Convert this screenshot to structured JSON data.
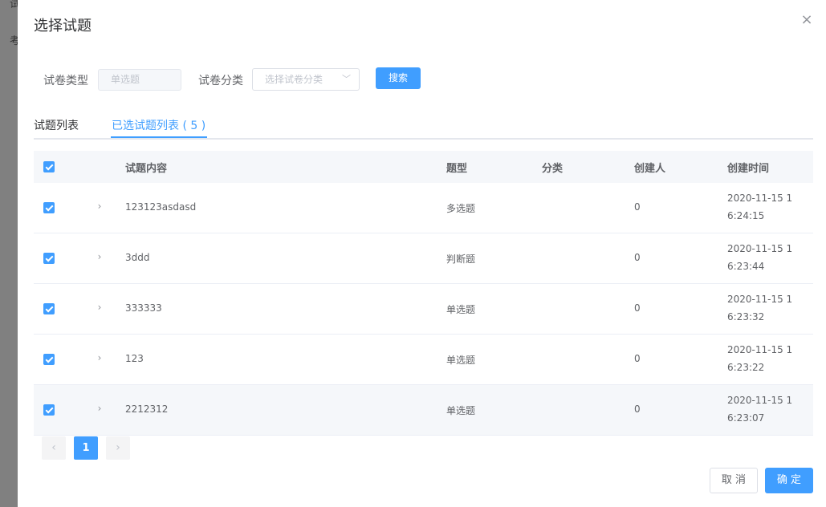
{
  "background": {
    "text1": "试",
    "text2": "考"
  },
  "dialog": {
    "title": "选择试题",
    "close_icon": "×"
  },
  "filters": {
    "type_label": "试卷类型",
    "type_value": "单选题",
    "category_label": "试卷分类",
    "category_placeholder": "选择试卷分类",
    "search_button": "搜索"
  },
  "tabs": {
    "list": "试题列表",
    "selected": "已选试题列表 ( 5 )"
  },
  "table": {
    "headers": {
      "content": "试题内容",
      "type": "题型",
      "category": "分类",
      "creator": "创建人",
      "time": "创建时间"
    },
    "rows": [
      {
        "content": "123123asdasd",
        "type": "多选题",
        "category": "",
        "creator": "0",
        "time": "2020-11-15 16:24:15"
      },
      {
        "content": "3ddd",
        "type": "判断题",
        "category": "",
        "creator": "0",
        "time": "2020-11-15 16:23:44"
      },
      {
        "content": "333333",
        "type": "单选题",
        "category": "",
        "creator": "0",
        "time": "2020-11-15 16:23:32"
      },
      {
        "content": "123",
        "type": "单选题",
        "category": "",
        "creator": "0",
        "time": "2020-11-15 16:23:22"
      },
      {
        "content": "2212312",
        "type": "单选题",
        "category": "",
        "creator": "0",
        "time": "2020-11-15 16:23:07"
      }
    ]
  },
  "pagination": {
    "prev": "‹",
    "current": "1",
    "next": "›"
  },
  "footer": {
    "cancel": "取 消",
    "confirm": "确 定"
  },
  "colors": {
    "primary": "#409eff",
    "header_bg": "#f5f7fa",
    "text": "#606266"
  }
}
